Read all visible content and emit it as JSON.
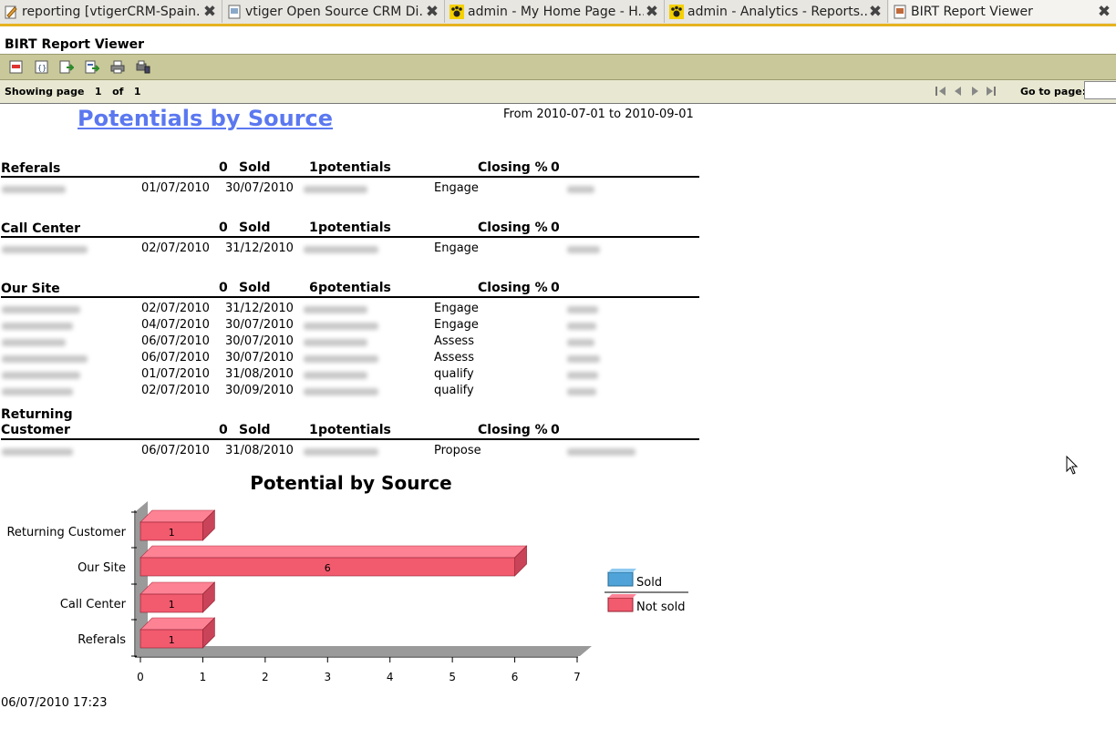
{
  "tabs": [
    {
      "label": "reporting [vtigerCRM-Spain...",
      "icon": "edit-icon"
    },
    {
      "label": "vtiger Open Source CRM Di...",
      "icon": "page-icon"
    },
    {
      "label": "admin - My Home Page - H...",
      "icon": "vtiger-paw-icon"
    },
    {
      "label": "admin - Analytics - Reports...",
      "icon": "vtiger-paw-icon"
    },
    {
      "label": "BIRT Report Viewer",
      "icon": "page-icon"
    }
  ],
  "viewer": {
    "title": "BIRT Report Viewer",
    "toolbar": [
      "toc-icon",
      "parameter-icon",
      "export-data-icon",
      "export-report-icon",
      "print-icon",
      "print-server-icon"
    ],
    "showing_label": "Showing page",
    "current_page": "1",
    "of_label": "of",
    "total_pages": "1",
    "goto_label": "Go to page:",
    "goto_value": ""
  },
  "report": {
    "title": "Potentials by Source",
    "range": "From 2010-07-01 to 2010-09-01",
    "groups": [
      {
        "name": "Referals",
        "sold_count": "0",
        "sold_label": "Sold",
        "potentials_count": "1",
        "potentials_label": "potentials",
        "closing_label": "Closing %",
        "closing_value": "0",
        "rows": [
          {
            "start": "01/07/2010",
            "close": "30/07/2010",
            "stage": "Engage"
          }
        ]
      },
      {
        "name": "Call Center",
        "sold_count": "0",
        "sold_label": "Sold",
        "potentials_count": "1",
        "potentials_label": "potentials",
        "closing_label": "Closing %",
        "closing_value": "0",
        "rows": [
          {
            "start": "02/07/2010",
            "close": "31/12/2010",
            "stage": "Engage"
          }
        ]
      },
      {
        "name": "Our Site",
        "sold_count": "0",
        "sold_label": "Sold",
        "potentials_count": "6",
        "potentials_label": "potentials",
        "closing_label": "Closing %",
        "closing_value": "0",
        "rows": [
          {
            "start": "02/07/2010",
            "close": "31/12/2010",
            "stage": "Engage"
          },
          {
            "start": "04/07/2010",
            "close": "30/07/2010",
            "stage": "Engage"
          },
          {
            "start": "06/07/2010",
            "close": "30/07/2010",
            "stage": "Assess"
          },
          {
            "start": "06/07/2010",
            "close": "30/07/2010",
            "stage": "Assess"
          },
          {
            "start": "01/07/2010",
            "close": "31/08/2010",
            "stage": "qualify"
          },
          {
            "start": "02/07/2010",
            "close": "30/09/2010",
            "stage": "qualify"
          }
        ]
      },
      {
        "name": "Returning Customer",
        "sold_count": "0",
        "sold_label": "Sold",
        "potentials_count": "1",
        "potentials_label": "potentials",
        "closing_label": "Closing %",
        "closing_value": "0",
        "rows": [
          {
            "start": "06/07/2010",
            "close": "31/08/2010",
            "stage": "Propose"
          }
        ]
      }
    ],
    "timestamp": "06/07/2010 17:23"
  },
  "chart_data": {
    "type": "bar",
    "orientation": "horizontal",
    "title": "Potential by Source",
    "categories": [
      "Referals",
      "Call Center",
      "Our Site",
      "Returning Customer"
    ],
    "series": [
      {
        "name": "Sold",
        "values": [
          0,
          0,
          0,
          0
        ],
        "color": "#4fa3d8"
      },
      {
        "name": "Not sold",
        "values": [
          1,
          1,
          6,
          1
        ],
        "color": "#f25a6e"
      }
    ],
    "xlim": [
      0,
      7
    ],
    "xticks": [
      "0",
      "1",
      "2",
      "3",
      "4",
      "5",
      "6",
      "7"
    ],
    "legend": "right",
    "grid": false
  }
}
